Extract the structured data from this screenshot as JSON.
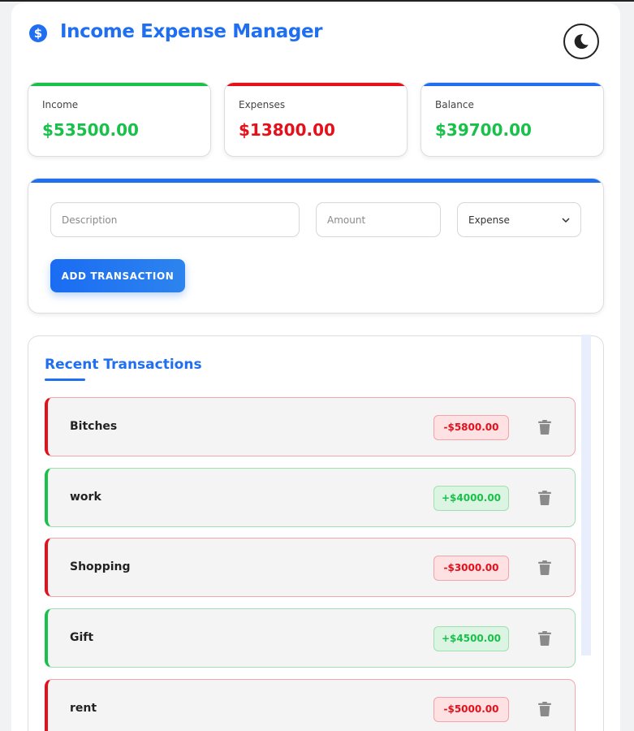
{
  "app": {
    "title": "Income Expense Manager",
    "logo_icon": "dollar-circle-icon",
    "logo_glyph": "$",
    "theme_toggle_icon": "moon-icon"
  },
  "summary": {
    "income": {
      "label": "Income",
      "value": "$53500.00",
      "color": "#19c04a"
    },
    "expenses": {
      "label": "Expenses",
      "value": "$13800.00",
      "color": "#e4101a"
    },
    "balance": {
      "label": "Balance",
      "value": "$39700.00",
      "color": "#19c04a"
    }
  },
  "form": {
    "description_placeholder": "Description",
    "amount_placeholder": "Amount",
    "type_selected": "Expense",
    "type_options": [
      "Expense"
    ],
    "submit_label": "ADD TRANSACTION"
  },
  "transactions": {
    "title": "Recent Transactions",
    "items": [
      {
        "description": "Bitches",
        "amount": "-$5800.00",
        "type": "expense"
      },
      {
        "description": "work",
        "amount": "+$4000.00",
        "type": "income"
      },
      {
        "description": "Shopping",
        "amount": "-$3000.00",
        "type": "expense"
      },
      {
        "description": "Gift",
        "amount": "+$4500.00",
        "type": "income"
      },
      {
        "description": "rent",
        "amount": "-$5000.00",
        "type": "expense"
      }
    ]
  },
  "colors": {
    "accent": "#1f6ff0",
    "income": "#19c04a",
    "expense": "#e4101a"
  }
}
